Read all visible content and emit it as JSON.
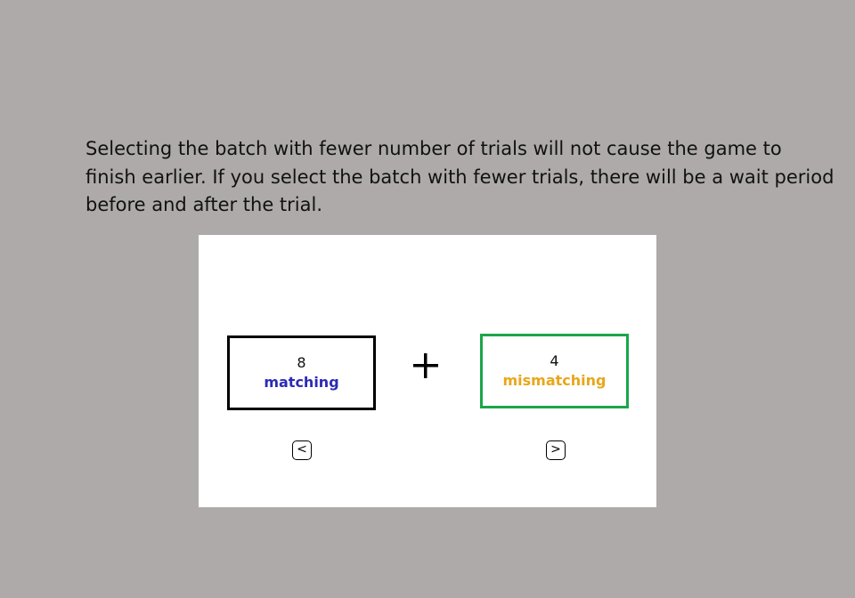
{
  "instructions": {
    "line1": "Selecting the batch with fewer number of trials will not cause the game to",
    "line2": "finish earlier.  If you select the batch with fewer trials, there will be a wait period",
    "line3": "before and after the trial."
  },
  "left_batch": {
    "count": "8",
    "label": "matching",
    "label_color": "#2b2bb5",
    "border_color": "#000000",
    "key": "<"
  },
  "right_batch": {
    "count": "4",
    "label": "mismatching",
    "label_color": "#e9a61a",
    "border_color": "#1aa64a",
    "key": ">"
  },
  "fixation_icon": "plus-icon",
  "colors": {
    "background": "#aeaaaa",
    "panel": "#ffffff"
  }
}
